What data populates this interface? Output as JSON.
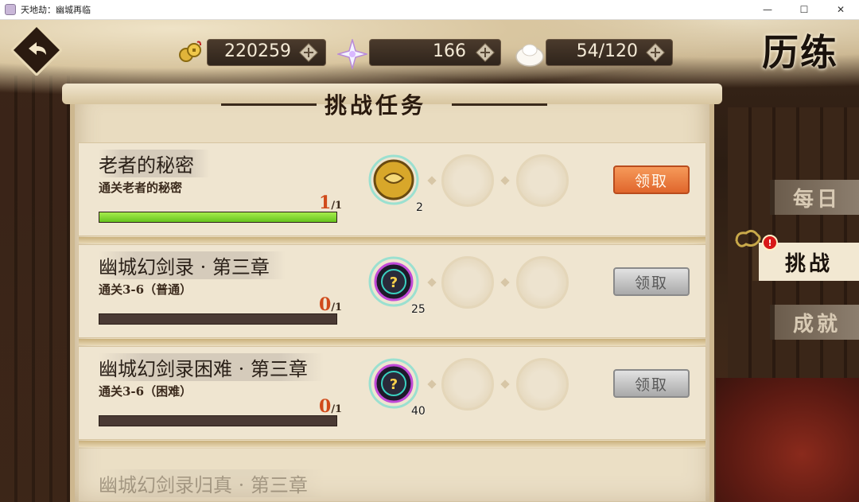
{
  "window": {
    "title": "天地劫：幽城再临",
    "minimize_glyph": "—",
    "maximize_glyph": "☐",
    "close_glyph": "✕"
  },
  "currencies": [
    {
      "name": "gold-coins",
      "value": "220259"
    },
    {
      "name": "star-crystal",
      "value": "166"
    },
    {
      "name": "stamina-bun",
      "value": "54/120"
    }
  ],
  "page_title": "历练",
  "section_title": "挑战任务",
  "tasks": [
    {
      "name": "老者的秘密",
      "desc": "通关老者的秘密",
      "progress_current": "1",
      "progress_total": "/1",
      "progress_fraction": 1.0,
      "reward_count": "2",
      "reward_icon": "gold-medallion-icon",
      "claim_label": "领取",
      "claim_enabled": true
    },
    {
      "name": "幽城幻剑录 · 第三章",
      "desc": "通关3-6（普通）",
      "progress_current": "0",
      "progress_total": "/1",
      "progress_fraction": 0.0,
      "reward_count": "25",
      "reward_icon": "mystery-orb-icon",
      "claim_label": "领取",
      "claim_enabled": false
    },
    {
      "name": "幽城幻剑录困难 · 第三章",
      "desc": "通关3-6（困难）",
      "progress_current": "0",
      "progress_total": "/1",
      "progress_fraction": 0.0,
      "reward_count": "40",
      "reward_icon": "mystery-orb-icon",
      "claim_label": "领取",
      "claim_enabled": false
    },
    {
      "name": "幽城幻剑录归真 · 第三章"
    }
  ],
  "side_tabs": [
    {
      "label": "每日",
      "active": false
    },
    {
      "label": "挑战",
      "active": true,
      "badge": "!"
    },
    {
      "label": "成就",
      "active": false
    }
  ],
  "colors": {
    "accent_orange": "#e0662c",
    "progress_green": "#67c51e",
    "paper": "#e9dcc0"
  }
}
